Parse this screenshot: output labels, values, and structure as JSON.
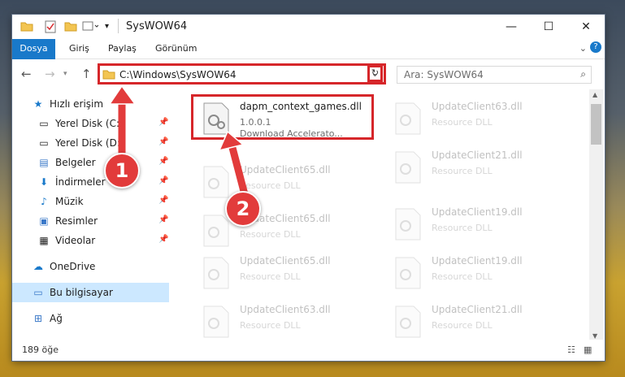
{
  "window": {
    "title": "SysWOW64"
  },
  "ribbon": {
    "tabs": [
      "Dosya",
      "Giriş",
      "Paylaş",
      "Görünüm"
    ]
  },
  "address": {
    "path": "C:\\Windows\\SysWOW64"
  },
  "search": {
    "placeholder": "Ara: SysWOW64"
  },
  "sidebar": {
    "items": [
      {
        "label": "Hızlı erişim",
        "icon": "star-icon"
      },
      {
        "label": "Yerel Disk (C:)",
        "icon": "drive-icon"
      },
      {
        "label": "Yerel Disk (D:)",
        "icon": "drive-icon"
      },
      {
        "label": "Belgeler",
        "icon": "documents-icon"
      },
      {
        "label": "İndirmeler",
        "icon": "download-icon"
      },
      {
        "label": "Müzik",
        "icon": "music-icon"
      },
      {
        "label": "Resimler",
        "icon": "pictures-icon"
      },
      {
        "label": "Videolar",
        "icon": "videos-icon"
      },
      {
        "label": "OneDrive",
        "icon": "cloud-icon"
      },
      {
        "label": "Bu bilgisayar",
        "icon": "computer-icon"
      },
      {
        "label": "Ağ",
        "icon": "network-icon"
      }
    ]
  },
  "files": {
    "main": {
      "name": "dapm_context_games.dll",
      "version": "1.0.0.1",
      "description": "Download Accelerato..."
    },
    "left": [
      {
        "name": "UpdateClient65.dll",
        "type": "Resource DLL"
      },
      {
        "name": "UpdateClient65.dll",
        "type": "Resource DLL"
      },
      {
        "name": "UpdateClient65.dll",
        "type": "Resource DLL"
      },
      {
        "name": "UpdateClient63.dll",
        "type": "Resource DLL"
      }
    ],
    "right": [
      {
        "name": "UpdateClient63.dll",
        "type": "Resource DLL"
      },
      {
        "name": "UpdateClient21.dll",
        "type": "Resource DLL"
      },
      {
        "name": "UpdateClient19.dll",
        "type": "Resource DLL"
      },
      {
        "name": "UpdateClient19.dll",
        "type": "Resource DLL"
      },
      {
        "name": "UpdateClient21.dll",
        "type": "Resource DLL"
      }
    ]
  },
  "status": {
    "count": "189 öğe"
  },
  "annotations": {
    "step1": "1",
    "step2": "2"
  },
  "colors": {
    "accent": "#1979ca",
    "highlight": "#d6262a",
    "selection": "#cce8ff"
  }
}
